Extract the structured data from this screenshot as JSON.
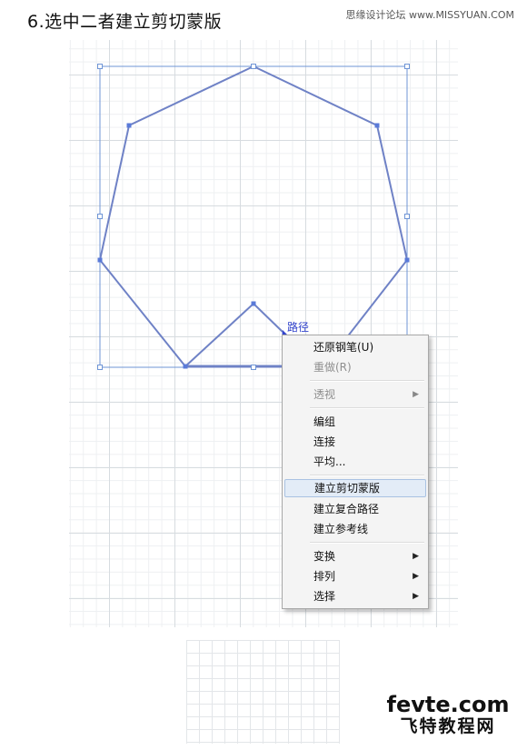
{
  "header": {
    "step_title": "6.选中二者建立剪切蒙版",
    "watermark": "思缘设计论坛 www.MISSYUAN.COM"
  },
  "canvas": {
    "path_label": "路径"
  },
  "context_menu": {
    "items": [
      {
        "label": "还原钢笔(U)",
        "enabled": true,
        "submenu": false
      },
      {
        "label": "重做(R)",
        "enabled": false,
        "submenu": false
      },
      {
        "label": "透视",
        "enabled": false,
        "submenu": true
      },
      {
        "label": "编组",
        "enabled": true,
        "submenu": false
      },
      {
        "label": "连接",
        "enabled": true,
        "submenu": false
      },
      {
        "label": "平均...",
        "enabled": true,
        "submenu": false
      },
      {
        "label": "建立剪切蒙版",
        "enabled": true,
        "submenu": false,
        "selected": true
      },
      {
        "label": "建立复合路径",
        "enabled": true,
        "submenu": false
      },
      {
        "label": "建立参考线",
        "enabled": true,
        "submenu": false
      },
      {
        "label": "变换",
        "enabled": true,
        "submenu": true
      },
      {
        "label": "排列",
        "enabled": true,
        "submenu": true
      },
      {
        "label": "选择",
        "enabled": true,
        "submenu": true
      }
    ],
    "submenu_arrow": "▶"
  },
  "logo": {
    "line1": "fevte.com",
    "line2": "飞特教程网"
  },
  "colors": {
    "path_stroke": "#6f82c6",
    "selection": "#6f95d6",
    "anchor": "#5a7ad8"
  }
}
